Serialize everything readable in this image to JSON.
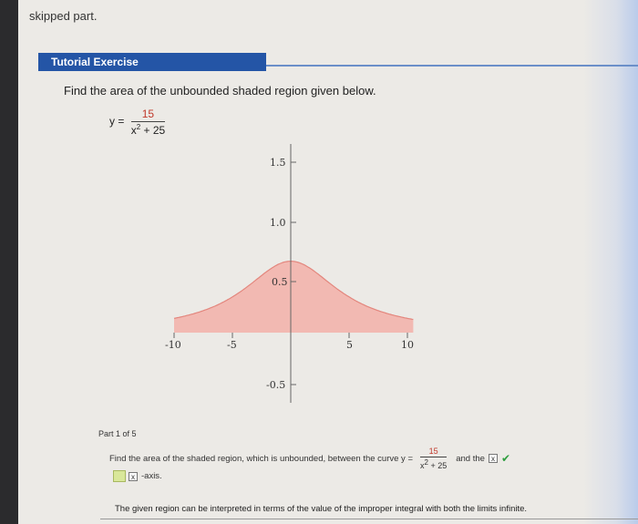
{
  "top_text": "skipped part.",
  "tutorial_header": "Tutorial Exercise",
  "prompt": "Find the area of the unbounded shaded region given below.",
  "equation": {
    "lhs": "y =",
    "numerator": "15",
    "denominator": "x",
    "exp": "2",
    "denominator_rest": " + 25"
  },
  "graph": {
    "y_ticks": [
      "1.5",
      "1.0",
      "0.5",
      "-0.5"
    ],
    "x_ticks": [
      "-10",
      "-5",
      "5",
      "10"
    ],
    "fill_color": "#f2b9b2"
  },
  "part_label": "Part 1 of 5",
  "question": {
    "before": "Find the area of the shaded region, which is unbounded, between the curve y =",
    "numerator": "15",
    "denominator": "x",
    "exp": "2",
    "denominator_rest": " + 25",
    "after": "and the",
    "box_mark": "x"
  },
  "answer": {
    "box_mark": "x",
    "suffix": "-axis."
  },
  "note": "The given region can be interpreted in terms of the value of the improper integral with both the limits infinite."
}
